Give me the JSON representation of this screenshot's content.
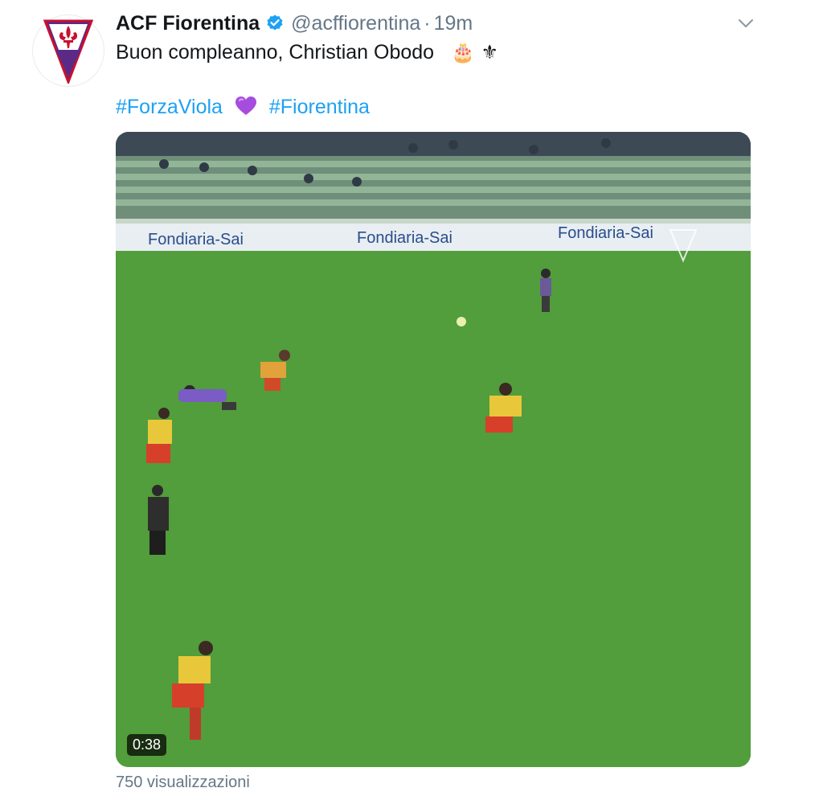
{
  "tweet": {
    "display_name": "ACF Fiorentina",
    "handle": "@acffiorentina",
    "separator": "·",
    "time": "19m",
    "text": "Buon compleanno, Christian Obodo",
    "text_emojis": "🎂 ⚜",
    "hashtags": [
      "#ForzaViola",
      "#Fiorentina"
    ],
    "media": {
      "duration": "0:38",
      "ad_boards": [
        "Fondiaria-Sai",
        "Fondiaria-Sai",
        "Fondiaria-Sai"
      ]
    },
    "views": "750 visualizzazioni"
  },
  "icons": [
    "fiorentina-logo-icon",
    "verified-icon",
    "chevron-down-icon",
    "purple-heart-icon"
  ],
  "colors": {
    "link": "#1da1f2",
    "secondary_text": "#657786",
    "verified": "#1da1f2",
    "pitch": "#4f9a3a",
    "viola": "#5b2a86"
  }
}
